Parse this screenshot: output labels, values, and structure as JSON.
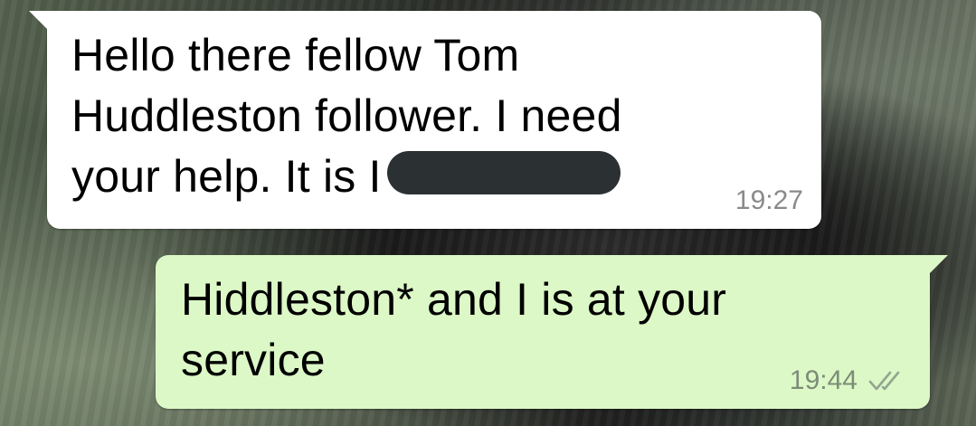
{
  "messages": {
    "incoming": {
      "lines": [
        "Hello there fellow Tom",
        "Huddleston follower. I need",
        "your help. It is I"
      ],
      "time": "19:27"
    },
    "outgoing": {
      "lines": [
        "Hiddleston* and I is at your",
        "service"
      ],
      "time": "19:44",
      "status_icon": "double-check-icon"
    }
  },
  "colors": {
    "incoming_bubble": "#ffffff",
    "outgoing_bubble": "#dcf8c6",
    "timestamp": "#8a8a8a",
    "redaction": "#2b3033"
  }
}
